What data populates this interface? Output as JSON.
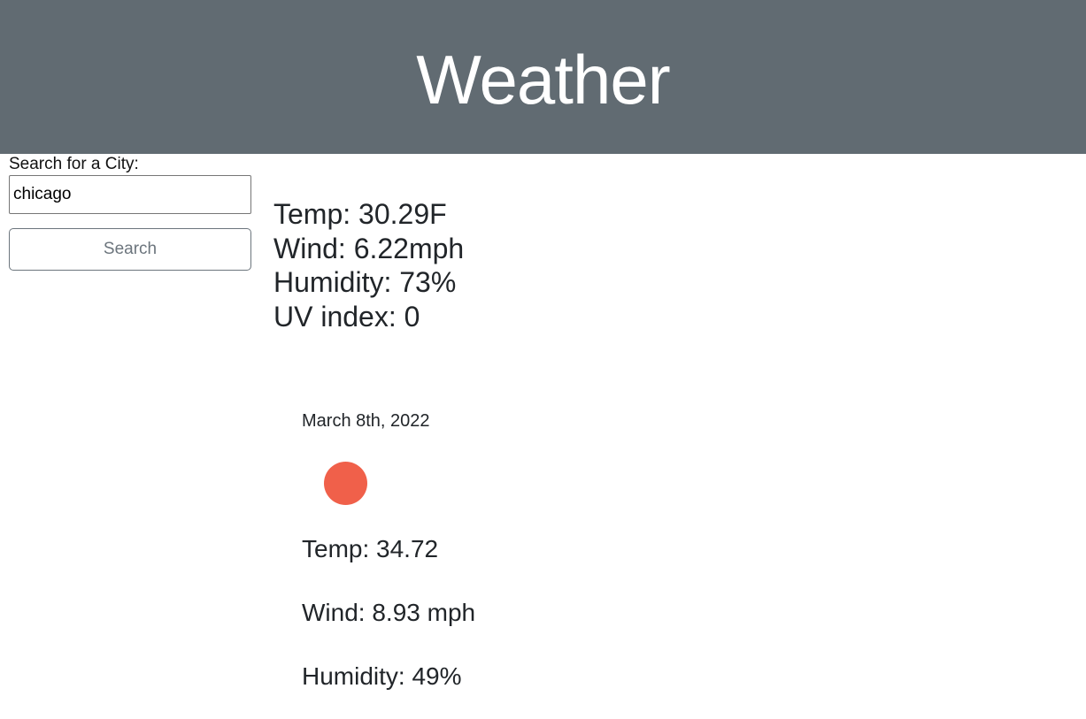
{
  "header": {
    "title": "Weather"
  },
  "search": {
    "label": "Search for a City:",
    "value": "chicago",
    "button_label": "Search"
  },
  "current": {
    "temp": "Temp: 30.29F",
    "wind": "Wind: 6.22mph",
    "humidity": "Humidity: 73%",
    "uv": "UV index: 0"
  },
  "forecast": {
    "date": "March 8th, 2022",
    "icon": "weather-icon",
    "icon_color": "#f0604a",
    "temp": "Temp: 34.72",
    "wind": "Wind: 8.93 mph",
    "humidity": "Humidity: 49%"
  },
  "colors": {
    "header_bg": "#616b72",
    "button_text": "#6c757d"
  }
}
